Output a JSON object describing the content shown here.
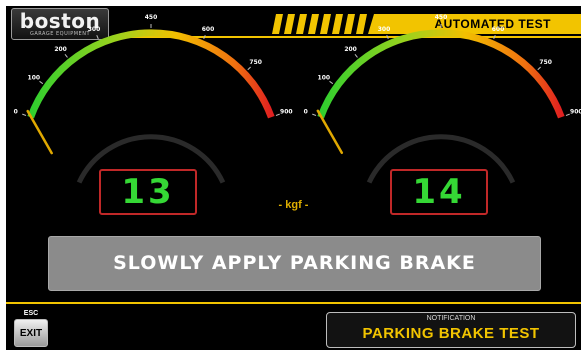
{
  "header": {
    "logo_word": "boston",
    "logo_subtitle": "GARAGE EQUIPMENT",
    "title": "AUTOMATED TEST"
  },
  "gauges": {
    "tick_labels": [
      "0",
      "100",
      "200",
      "300",
      "450",
      "600",
      "750",
      "900"
    ],
    "tick_values": [
      0,
      100,
      200,
      300,
      450,
      600,
      750,
      900
    ],
    "max": 900,
    "left": {
      "reading": "13",
      "value": 13
    },
    "right": {
      "reading": "14",
      "value": 14
    }
  },
  "unit_label": "- kgf -",
  "instruction": "SLOWLY APPLY PARKING BRAKE",
  "footer": {
    "esc_caption": "ESC",
    "exit_label": "EXIT",
    "notification_caption": "NOTIFICATION",
    "notification_text": "PARKING BRAKE TEST"
  },
  "colors": {
    "accent_yellow": "#f2c400",
    "readout_green": "#35d835",
    "readout_border": "#c02828",
    "needle": "#e0a800"
  }
}
